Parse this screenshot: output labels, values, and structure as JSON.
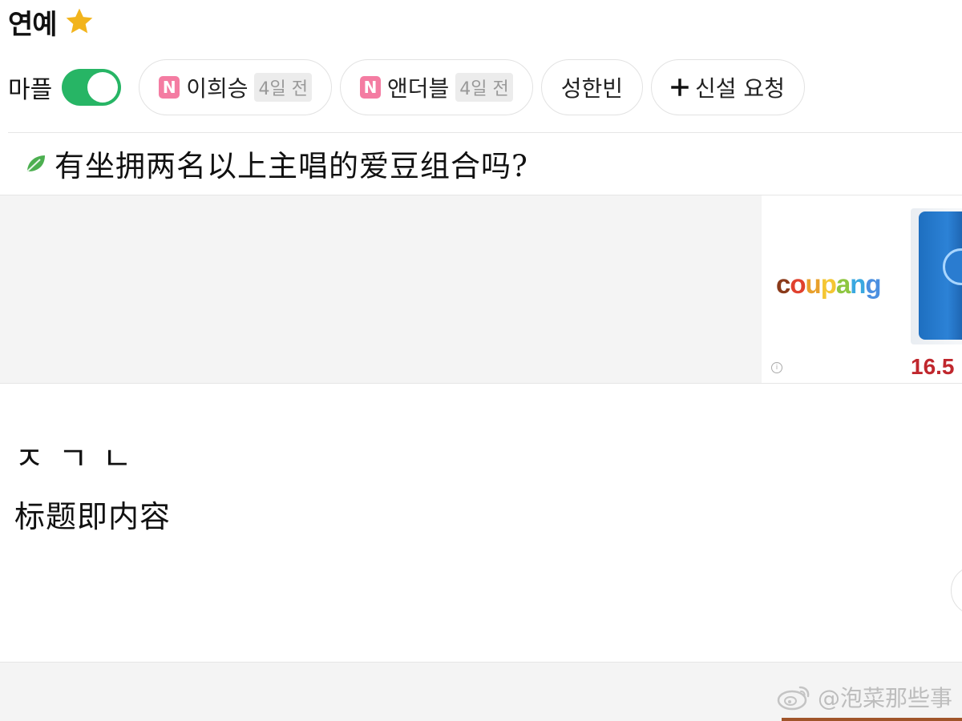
{
  "header": {
    "title": "연예",
    "star_icon": "star-icon",
    "accent_color": "#f2b41c"
  },
  "chips": {
    "mapple_label": "마플",
    "toggle_on": true,
    "toggle_color": "#27b565",
    "items": [
      {
        "badge": "N",
        "label": "이희승",
        "time": "4일 전"
      },
      {
        "badge": "N",
        "label": "앤더블",
        "time": "4일 전"
      },
      {
        "label": "성한빈"
      },
      {
        "icon": "plus-icon",
        "label": "신설 요청"
      }
    ],
    "badge_color": "#f47ca2"
  },
  "post": {
    "title": "有坐拥两名以上主唱的爱豆组合吗?",
    "leaf_icon": "leaf-icon",
    "body_jamo": "ㅈㄱㄴ",
    "body_text": "标题即内容"
  },
  "ad": {
    "logo": [
      "c",
      "o",
      "u",
      "p",
      "a",
      "n",
      "g"
    ],
    "price": "16.5",
    "info_icon": "info-icon",
    "info_glyph": "i"
  },
  "watermark": {
    "text": "@泡菜那些事",
    "icon": "weibo-icon"
  }
}
